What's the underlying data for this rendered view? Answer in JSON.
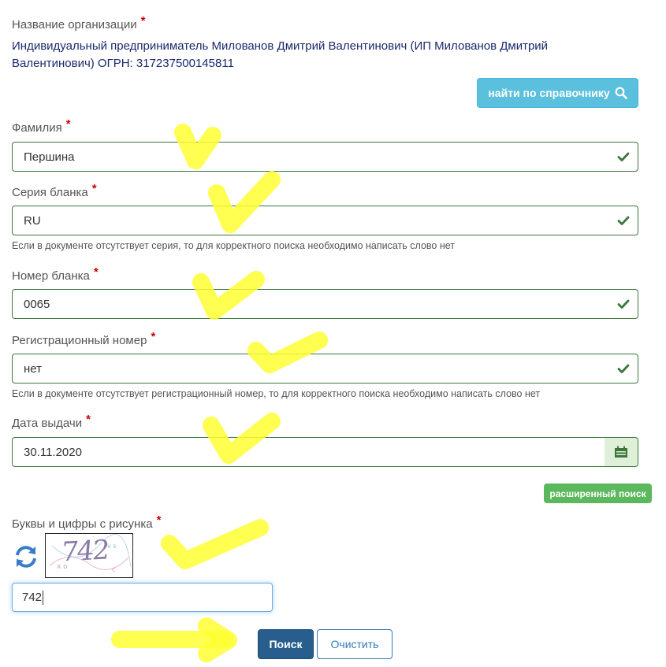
{
  "org": {
    "label": "Название организации",
    "required": "*",
    "value": "Индивидуальный предприниматель Милованов Дмитрий Валентинович (ИП Милованов Дмитрий Валентинович) ОГРН: 317237500145811",
    "lookup_button": "найти по справочнику"
  },
  "surname": {
    "label": "Фамилия",
    "required": "*",
    "value": "Першина"
  },
  "series": {
    "label": "Серия бланка",
    "required": "*",
    "value": "RU",
    "help": "Если в документе отсутствует серия, то для корректного поиска необходимо написать слово нет"
  },
  "number": {
    "label": "Номер бланка",
    "required": "*",
    "value": "0065"
  },
  "regnum": {
    "label": "Регистрационный номер",
    "required": "*",
    "value": "нет",
    "help": "Если в документе отсутствует регистрационный номер, то для корректного поиска необходимо написать слово нет"
  },
  "issue_date": {
    "label": "Дата выдачи",
    "required": "*",
    "value": "30.11.2020"
  },
  "advanced_search_button": "расширенный поиск",
  "captcha": {
    "label": "Буквы и цифры с рисунка",
    "required": "*",
    "image_text": "742",
    "value": "742"
  },
  "actions": {
    "search": "Поиск",
    "clear": "Очистить"
  },
  "colors": {
    "valid_border": "#3c763d",
    "info_button": "#5bc0de",
    "success_button": "#5cb85c",
    "primary_button": "#285e8e",
    "highlighter": "#ffff33"
  },
  "icons": [
    "search-icon",
    "check-icon",
    "calendar-icon",
    "refresh-icon"
  ]
}
